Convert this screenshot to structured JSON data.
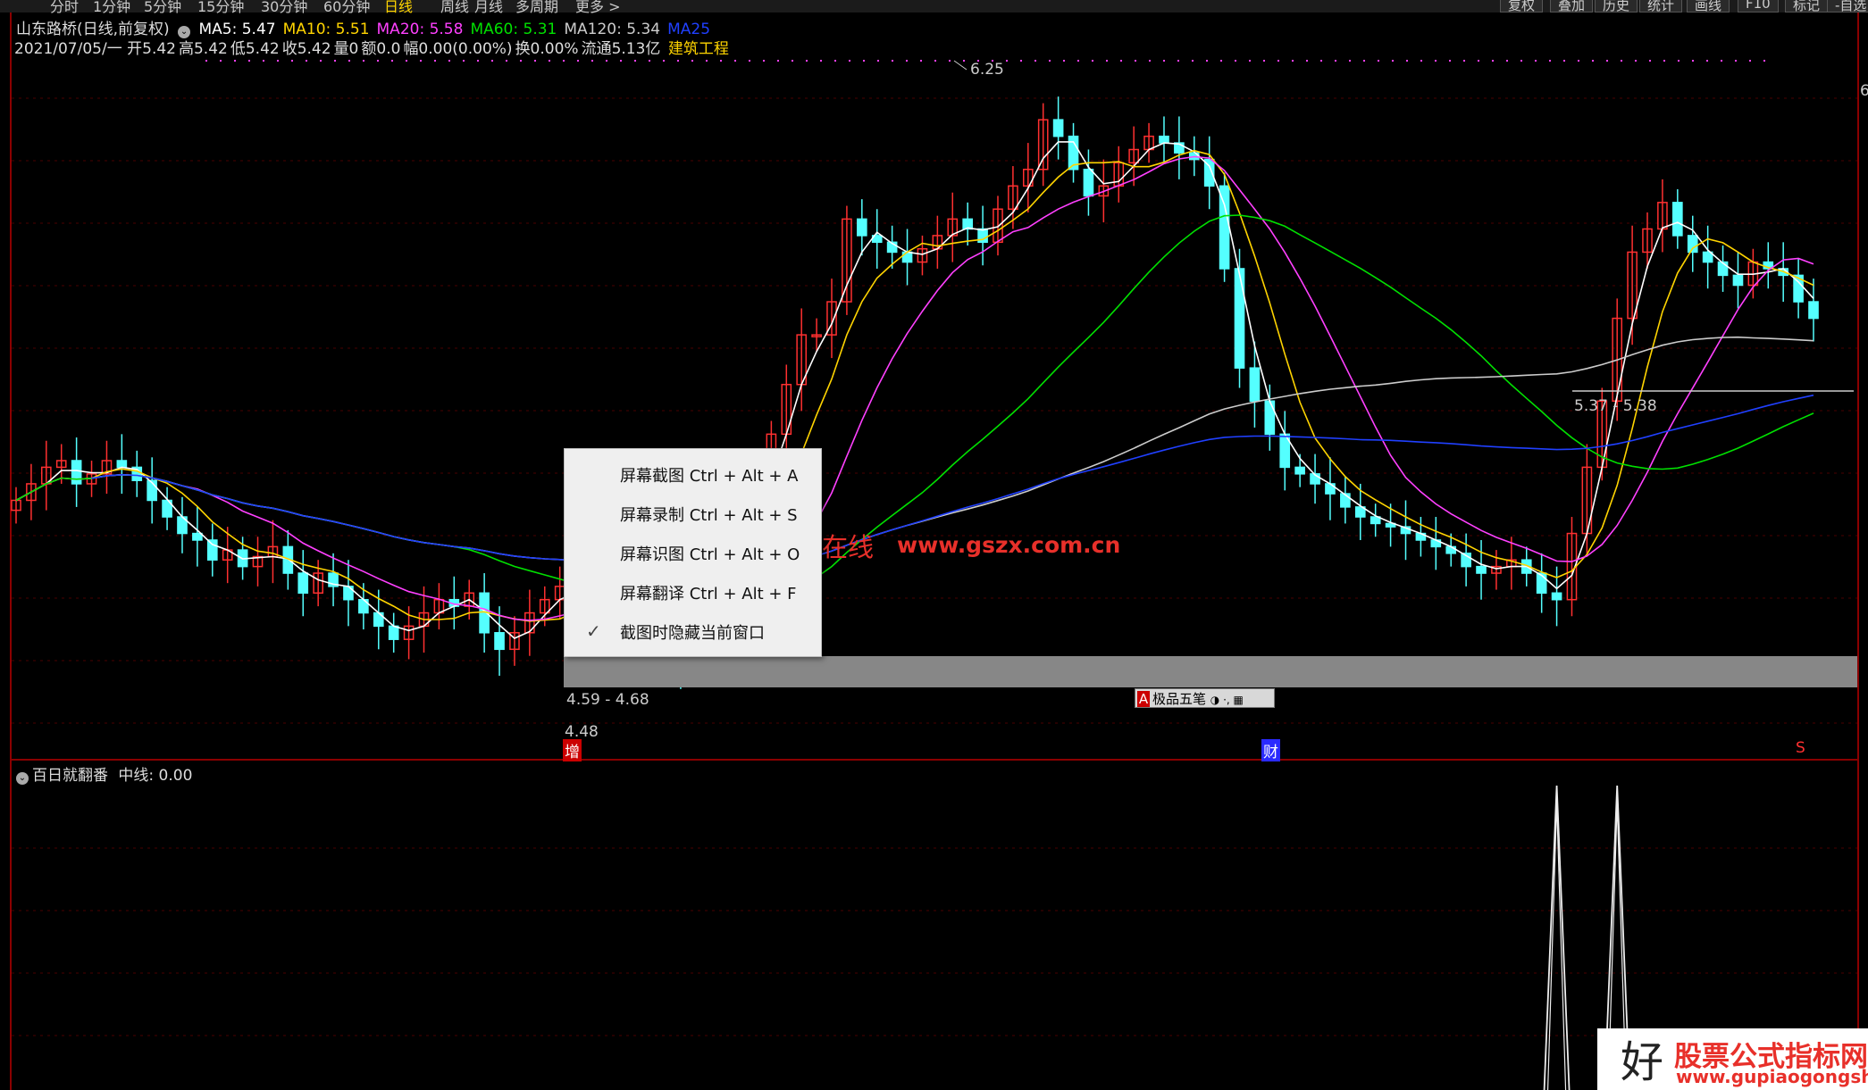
{
  "toolbar": {
    "timeframes": [
      "分时",
      "1分钟",
      "5分钟",
      "15分钟",
      "30分钟",
      "60分钟",
      "日线",
      "周线",
      "月线",
      "多周期",
      "更多 >"
    ],
    "active_timeframe": "日线",
    "right_buttons": [
      "复权",
      "叠加",
      "历史",
      "统计",
      "画线",
      "F10",
      "标记",
      "-自选"
    ]
  },
  "header": {
    "stock_title": "山东路桥(日线,前复权)",
    "ma": [
      {
        "label": "MA5: 5.47",
        "color": "#ffffff"
      },
      {
        "label": "MA10: 5.51",
        "color": "#ffd400"
      },
      {
        "label": "MA20: 5.58",
        "color": "#ff40ff"
      },
      {
        "label": "MA60: 5.31",
        "color": "#00e000"
      },
      {
        "label": "MA120: 5.34",
        "color": "#cccccc"
      },
      {
        "label": "MA25",
        "color": "#2040ff"
      }
    ],
    "quote_date": "2021/07/05/一",
    "quote_parts": [
      "开5.42",
      "高5.42",
      "低5.42",
      "收5.42",
      "量0",
      "额0.0",
      "幅0.00(0.00%)",
      "换0.00%",
      "流通5.13亿"
    ],
    "sector": "建筑工程"
  },
  "labels": {
    "high_peak": "6.25",
    "low_range": "4.59 - 4.68",
    "low_point": "4.48",
    "right_range": "5.37 - 5.38",
    "axis_right": "6"
  },
  "markers": [
    {
      "text": "增",
      "color": "#ffffff",
      "bg": "#cc0000"
    },
    {
      "text": "财",
      "color": "#ffffff",
      "bg": "#2a2aff"
    },
    {
      "text": "S",
      "color": "#ff3030",
      "bg": "transparent"
    }
  ],
  "context_menu": {
    "items": [
      {
        "label": "屏幕截图 Ctrl + Alt + A",
        "checked": false
      },
      {
        "label": "屏幕录制 Ctrl + Alt + S",
        "checked": false
      },
      {
        "label": "屏幕识图 Ctrl + Alt + O",
        "checked": false
      },
      {
        "label": "屏幕翻译 Ctrl + Alt + F",
        "checked": false
      },
      {
        "label": "截图时隐藏当前窗口",
        "checked": true
      }
    ],
    "check_glyph": "✓"
  },
  "brush_toolbar": {
    "icon_letter": "A",
    "label": "极品五笔",
    "extra": "◑ ·, ▦"
  },
  "indicator": {
    "name": "百日就翻番",
    "value": "中线: 0.00"
  },
  "watermark": {
    "cn": "公式在线",
    "url": "www.gszx.com.cn"
  },
  "logo": {
    "hao": "好",
    "brand": "股票公式指标网",
    "url": "www.gupiaogongshi.com"
  },
  "colors": {
    "up": "#ff3030",
    "down": "#54ffff",
    "ma5": "#ffffff",
    "ma10": "#ffd400",
    "ma20": "#ff40ff",
    "ma60": "#00e000",
    "ma120": "#cccccc",
    "ma250": "#2040ff",
    "divider": "#8b0000"
  },
  "chart_data": {
    "type": "candlestick",
    "price_range": [
      4.3,
      6.35
    ],
    "closes": [
      5.0,
      5.05,
      5.1,
      5.12,
      5.05,
      5.08,
      5.12,
      5.1,
      5.06,
      5.0,
      4.95,
      4.9,
      4.88,
      4.82,
      4.85,
      4.8,
      4.83,
      4.86,
      4.78,
      4.72,
      4.78,
      4.74,
      4.7,
      4.66,
      4.62,
      4.58,
      4.62,
      4.66,
      4.7,
      4.68,
      4.72,
      4.6,
      4.55,
      4.6,
      4.66,
      4.7,
      4.74,
      4.72,
      4.7,
      4.68,
      4.64,
      4.6,
      4.58,
      4.52,
      4.5,
      4.6,
      4.7,
      4.8,
      4.95,
      5.05,
      5.2,
      5.35,
      5.5,
      5.5,
      5.6,
      5.85,
      5.8,
      5.78,
      5.75,
      5.72,
      5.76,
      5.8,
      5.85,
      5.82,
      5.78,
      5.88,
      5.95,
      6.0,
      6.15,
      6.1,
      6.0,
      5.92,
      5.95,
      6.02,
      6.06,
      6.1,
      6.08,
      6.05,
      6.03,
      5.95,
      5.7,
      5.4,
      5.3,
      5.2,
      5.1,
      5.08,
      5.05,
      5.02,
      4.98,
      4.95,
      4.93,
      4.92,
      4.9,
      4.88,
      4.86,
      4.84,
      4.8,
      4.78,
      4.8,
      4.82,
      4.78,
      4.72,
      4.7,
      4.9,
      5.1,
      5.3,
      5.55,
      5.75,
      5.82,
      5.9,
      5.8,
      5.75,
      5.72,
      5.68,
      5.65,
      5.72,
      5.7,
      5.68,
      5.6,
      5.55
    ],
    "indicator_peaks": [
      {
        "index": 102,
        "value": 1
      },
      {
        "index": 106,
        "value": 1
      }
    ]
  }
}
